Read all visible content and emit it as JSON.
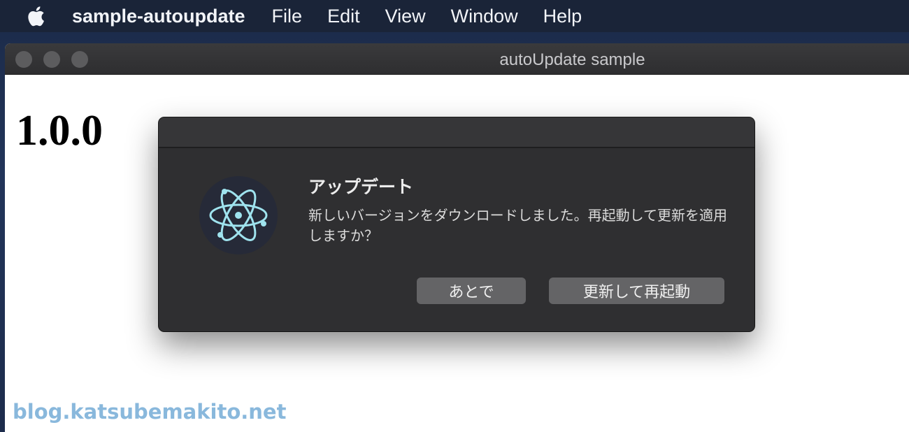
{
  "menubar": {
    "app_name": "sample-autoupdate",
    "items": [
      "File",
      "Edit",
      "View",
      "Window",
      "Help"
    ]
  },
  "window": {
    "title": "autoUpdate sample",
    "version_text": "1.0.0"
  },
  "dialog": {
    "title": "アップデート",
    "message": "新しいバージョンをダウンロードしました。再起動して更新を適用しますか？",
    "buttons": {
      "later": "あとで",
      "restart": "更新して再起動"
    },
    "icon": "electron-atom-icon"
  },
  "watermark": "blog.katsubemakito.net",
  "colors": {
    "dialog_bg": "#2f2f31",
    "button_bg": "#646466",
    "watermark": "#89b8dc",
    "icon_accent": "#9fe3ee"
  }
}
